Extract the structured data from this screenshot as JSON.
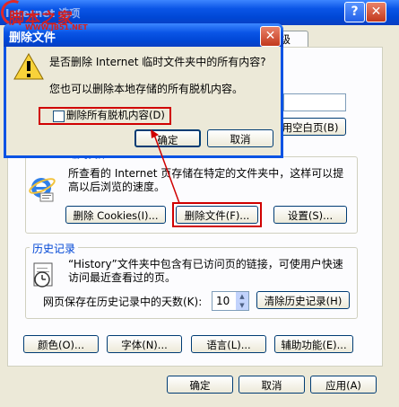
{
  "watermark": {
    "text_cn": "脚本之家",
    "text_en": "WWW.JB51.NET"
  },
  "outer": {
    "title_partial": "Internet 选项",
    "tab_visible": "级",
    "blank_page_button": "用空白页(B)",
    "temp_files_group": "Internet 临时文件",
    "temp_files_desc": "所查看的 Internet 页存储在特定的文件夹中，这样可以提高以后浏览的速度。",
    "delete_cookies": "删除 Cookies(I)...",
    "delete_files": "删除文件(F)...",
    "settings": "设置(S)...",
    "history_group": "历史记录",
    "history_desc": "“History”文件夹中包含有已访问页的链接，可使用户快速访问最近查看过的页。",
    "days_label": "网页保存在历史记录中的天数(K):",
    "days_value": "10",
    "clear_history": "清除历史记录(H)",
    "colors": "颜色(O)...",
    "fonts": "字体(N)...",
    "languages": "语言(L)...",
    "accessibility": "辅助功能(E)...",
    "ok": "确定",
    "cancel": "取消",
    "apply": "应用(A)"
  },
  "dialog": {
    "title": "删除文件",
    "question": "是否删除 Internet 临时文件夹中的所有内容?",
    "note": "您也可以删除本地存储的所有脱机内容。",
    "checkbox_label": "删除所有脱机内容(D)",
    "checkbox_checked": false,
    "ok": "确定",
    "cancel": "取消"
  },
  "colors": {
    "highlight": "#d00000",
    "titlebar": "#0a55e6"
  },
  "icons": [
    "help-icon",
    "close-icon",
    "warning-icon",
    "ie-icon",
    "history-icon"
  ]
}
